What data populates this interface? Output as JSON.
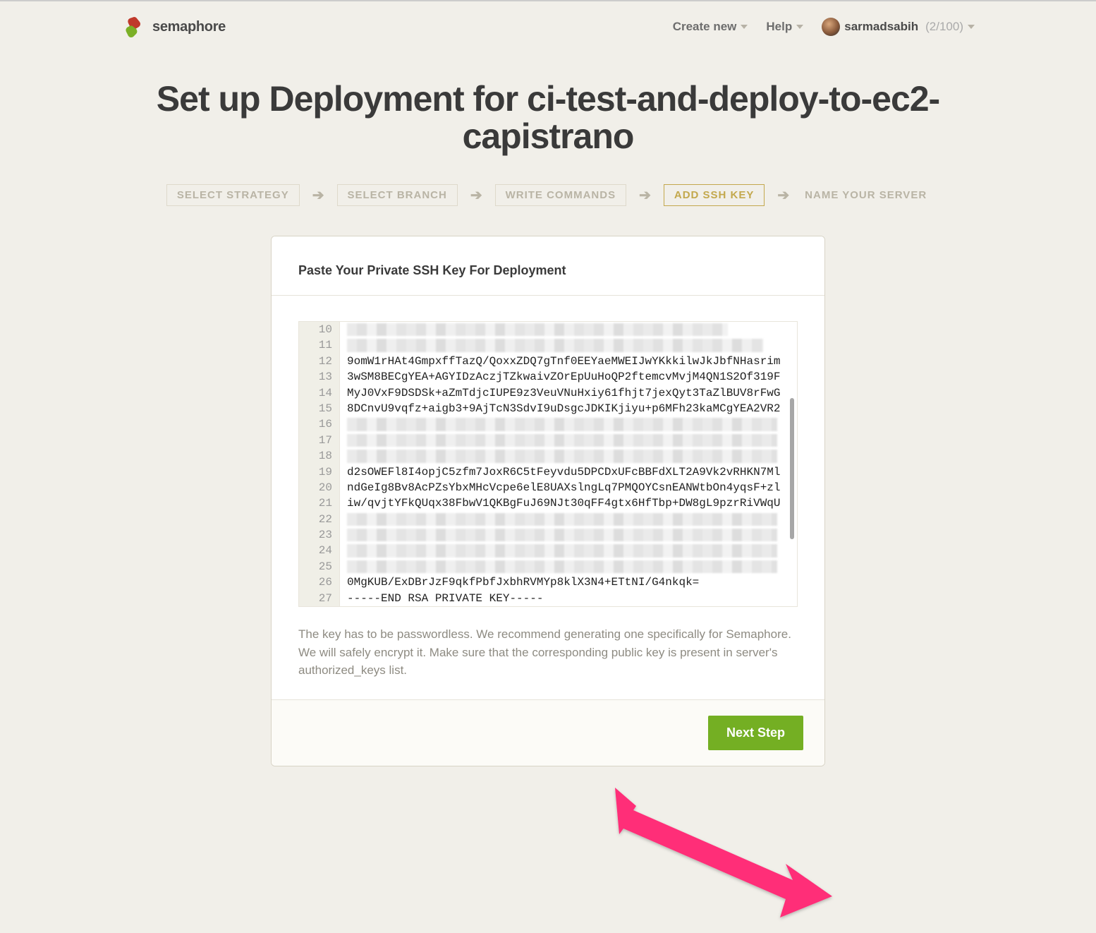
{
  "header": {
    "brand": "semaphore",
    "create_new": "Create new",
    "help": "Help",
    "username": "sarmadsabih",
    "usage": "(2/100)"
  },
  "page_title": "Set up Deployment for ci-test-and-deploy-to-ec2-capistrano",
  "steps": {
    "items": [
      {
        "label": "SELECT STRATEGY",
        "active": false,
        "bordered": true
      },
      {
        "label": "SELECT BRANCH",
        "active": false,
        "bordered": true
      },
      {
        "label": "WRITE COMMANDS",
        "active": false,
        "bordered": true
      },
      {
        "label": "ADD SSH KEY",
        "active": true,
        "bordered": true
      },
      {
        "label": "NAME YOUR SERVER",
        "active": false,
        "bordered": false
      }
    ]
  },
  "panel": {
    "title": "Paste Your Private SSH Key For Deployment",
    "helper": "The key has to be passwordless. We recommend generating one specifically for Semaphore. We will safely encrypt it. Make sure that the corresponding public key is present in server's authorized_keys list.",
    "next_button": "Next Step"
  },
  "code": {
    "lines": [
      {
        "num": 10,
        "text": "",
        "mosaic": "short"
      },
      {
        "num": 11,
        "text": "",
        "mosaic": "mid"
      },
      {
        "num": 12,
        "text": "9omW1rHAt4GmpxffTazQ/QoxxZDQ7gTnf0EEYaeMWEIJwYKkkilwJkJbfNHasrim"
      },
      {
        "num": 13,
        "text": "3wSM8BECgYEA+AGYIDzAczjTZkwaivZOrEpUuHoQP2ftemcvMvjM4QN1S2Of319F"
      },
      {
        "num": 14,
        "text": "MyJ0VxF9DSDSk+aZmTdjcIUPE9z3VeuVNuHxiy61fhjt7jexQyt3TaZlBUV8rFwG"
      },
      {
        "num": 15,
        "text": "8DCnvU9vqfz+aigb3+9AjTcN3SdvI9uDsgcJDKIKjiyu+p6MFh23kaMCgYEA2VR2"
      },
      {
        "num": 16,
        "text": "",
        "mosaic": "full"
      },
      {
        "num": 17,
        "text": "",
        "mosaic": "full"
      },
      {
        "num": 18,
        "text": "",
        "mosaic": "full"
      },
      {
        "num": 19,
        "text": "d2sOWEFl8I4opjC5zfm7JoxR6C5tFeyvdu5DPCDxUFcBBFdXLT2A9Vk2vRHKN7Ml"
      },
      {
        "num": 20,
        "text": "ndGeIg8Bv8AcPZsYbxMHcVcpe6elE8UAXslngLq7PMQOYCsnEANWtbOn4yqsF+zl"
      },
      {
        "num": 21,
        "text": "iw/qvjtYFkQUqx38FbwV1QKBgFuJ69NJt30qFF4gtx6HfTbp+DW8gL9pzrRiVWqU"
      },
      {
        "num": 22,
        "text": "",
        "mosaic": "full"
      },
      {
        "num": 23,
        "text": "",
        "mosaic": "full"
      },
      {
        "num": 24,
        "text": "",
        "mosaic": "full"
      },
      {
        "num": 25,
        "text": "",
        "mosaic": "full"
      },
      {
        "num": 26,
        "text": "0MgKUB/ExDBrJzF9qkfPbfJxbhRVMYp8klX3N4+ETtNI/G4nkqk="
      },
      {
        "num": 27,
        "text": "-----END RSA PRIVATE KEY-----"
      }
    ]
  }
}
